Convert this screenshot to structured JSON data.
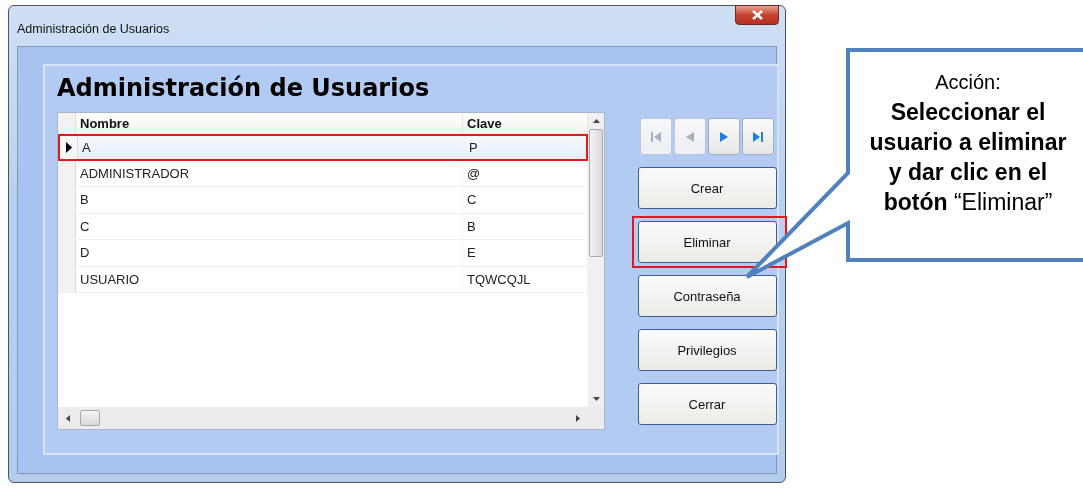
{
  "window": {
    "title": "Administración de Usuarios"
  },
  "heading": "Administración de Usuarios",
  "table": {
    "columns": [
      "Nombre",
      "Clave"
    ],
    "rows": [
      {
        "cells": [
          "A",
          "P"
        ],
        "selected": true,
        "highlighted": true
      },
      {
        "cells": [
          "ADMINISTRADOR",
          "@"
        ],
        "selected": false,
        "highlighted": false
      },
      {
        "cells": [
          "B",
          "C"
        ],
        "selected": false,
        "highlighted": false
      },
      {
        "cells": [
          "C",
          "B"
        ],
        "selected": false,
        "highlighted": false
      },
      {
        "cells": [
          "D",
          "E"
        ],
        "selected": false,
        "highlighted": false
      },
      {
        "cells": [
          "USUARIO",
          "TQWCQJL"
        ],
        "selected": false,
        "highlighted": false
      }
    ]
  },
  "navigator": [
    {
      "kind": "first",
      "disabled": true
    },
    {
      "kind": "prev",
      "disabled": true
    },
    {
      "kind": "next",
      "disabled": false
    },
    {
      "kind": "last",
      "disabled": false
    }
  ],
  "buttons": [
    {
      "label": "Crear",
      "highlighted": false
    },
    {
      "label": "Eliminar",
      "highlighted": true
    },
    {
      "label": "Contraseña",
      "highlighted": false
    },
    {
      "label": "Privilegios",
      "highlighted": false
    },
    {
      "label": "Cerrar",
      "highlighted": false
    }
  ],
  "callout": {
    "heading": "Acción:",
    "text": "**Seleccionar el usuario a eliminar y dar clic en el botón** “Eliminar”"
  }
}
